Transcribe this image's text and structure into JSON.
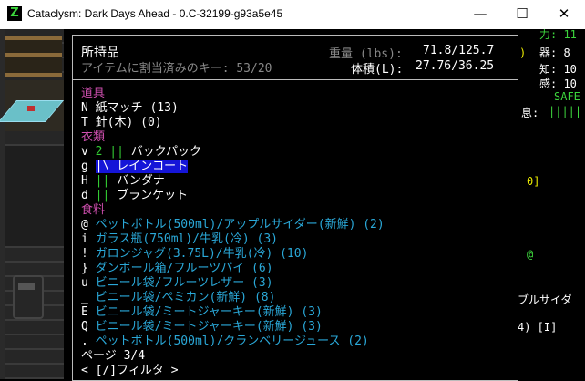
{
  "window": {
    "title": "Cataclysm: Dark Days Ahead - 0.C-32199-g93a5e45",
    "app_icon": "Z",
    "minimize": "—",
    "maximize": "☐",
    "close": "✕"
  },
  "inventory": {
    "title": "所持品",
    "keys_label": "アイテムに割当済みのキー: 53/20",
    "weight_label": "重量 (lbs):",
    "weight_value": "71.8/125.7",
    "volume_label": "体積(L):",
    "volume_value": "27.76/36.25",
    "categories": [
      {
        "name": "道具",
        "items": [
          {
            "key": "N",
            "mark": "",
            "name": "紙マッチ (13)",
            "selected": false
          },
          {
            "key": "T",
            "mark": "",
            "name": "針(木) (0)",
            "selected": false
          }
        ]
      },
      {
        "name": "衣類",
        "items": [
          {
            "key": "v",
            "mark": "2 || ",
            "name": "バックパック",
            "selected": false
          },
          {
            "key": "g",
            "mark": "|\\ ",
            "name": "レインコート",
            "selected": true
          },
          {
            "key": "H",
            "mark": "|| ",
            "name": "バンダナ",
            "selected": false
          },
          {
            "key": "d",
            "mark": "|| ",
            "name": "ブランケット",
            "selected": false
          }
        ]
      },
      {
        "name": "食料",
        "items": [
          {
            "key": "@",
            "mark": "",
            "name": "ペットボトル(500ml)/アップルサイダー(新鮮) (2)",
            "selected": false
          },
          {
            "key": "i",
            "mark": "",
            "name": "ガラス瓶(750ml)/牛乳(冷) (3)",
            "selected": false
          },
          {
            "key": "!",
            "mark": "",
            "name": "ガロンジャグ(3.75L)/牛乳(冷) (10)",
            "selected": false
          },
          {
            "key": "}",
            "mark": "",
            "name": "ダンボール箱/フルーツパイ (6)",
            "selected": false
          },
          {
            "key": "u",
            "mark": "",
            "name": "ビニール袋/フルーツレザー (3)",
            "selected": false
          },
          {
            "key": "_",
            "mark": "",
            "name": "ビニール袋/ペミカン(新鮮) (8)",
            "selected": false
          },
          {
            "key": "E",
            "mark": "",
            "name": "ビニール袋/ミートジャーキー(新鮮) (3)",
            "selected": false
          },
          {
            "key": "Q",
            "mark": "",
            "name": "ビニール袋/ミートジャーキー(新鮮) (3)",
            "selected": false
          },
          {
            "key": ".",
            "mark": "",
            "name": "ペットボトル(500ml)/クランベリージュース (2)",
            "selected": false
          }
        ]
      }
    ],
    "page": "ページ 3/4",
    "filter": "< [/]フィルタ >"
  },
  "sidebar": {
    "stat_power": "力: 11",
    "stat_dex": "器: 8",
    "stat_int": "知: 10",
    "stat_per": "感: 10",
    "safe": "SAFE",
    "rest_label": "息:",
    "rest_bar": "|||||",
    "bracket": "0]",
    "at_symbol": "@",
    "paren": ")",
    "msg1": "ブルサイダ",
    "msg2": "4) [I]"
  },
  "colors": {
    "category": "#d050b0",
    "food": "#2aa8d8",
    "highlight": "#1515d8",
    "durability": "#33cc33",
    "safe": "#33cc33",
    "sidebar_yellow": "#e8e800",
    "stat_green": "#3cd43c"
  }
}
